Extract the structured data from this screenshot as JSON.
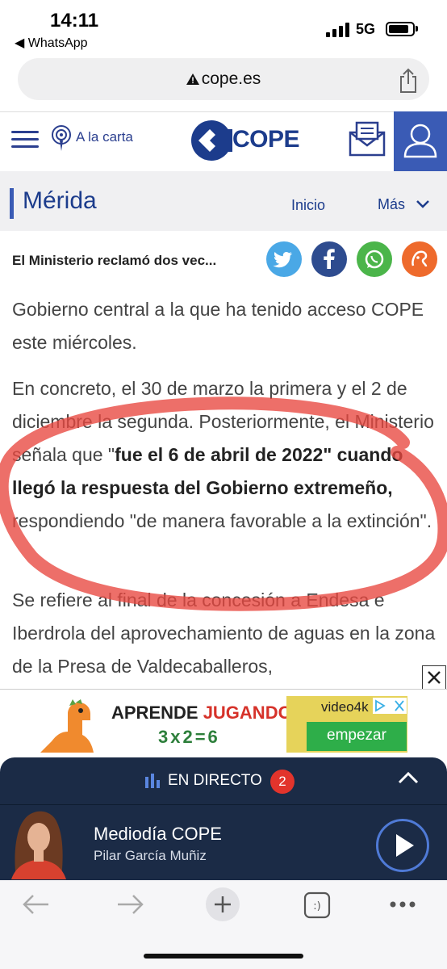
{
  "status_bar": {
    "time": "14:11",
    "back_app": "◀ WhatsApp",
    "network": "5G"
  },
  "browser": {
    "url": "cope.es"
  },
  "site_header": {
    "carta_label": "A la carta",
    "brand": "COPE"
  },
  "section": {
    "title": "Mérida",
    "nav_inicio": "Inicio",
    "nav_mas": "Más"
  },
  "share_strip": {
    "headline": "El Ministerio reclamó dos vec..."
  },
  "article": {
    "p1": "Gobierno central a la que ha tenido acceso COPE este miércoles.",
    "p2_a": "En concreto, el 30 de marzo la primera y el 2 de diciembre la segunda. Posteriormente, el Ministerio señala que \"",
    "p2_bold": "fue el 6 de abril de 2022\" cuando llegó la respuesta del Gobierno extremeño,",
    "p2_b": " respondiendo \"de manera favorable a la extinción\".",
    "p3": "Se refiere al final de la concesión a Endesa e Iberdrola del aprovechamiento de aguas en la zona de la Presa de Valdecaballeros,"
  },
  "ad": {
    "line1_a": "APRENDE ",
    "line1_b": "JUGANDO",
    "line2": "3x2=6",
    "brand": "video4k",
    "cta": "empezar"
  },
  "player": {
    "live_label": "EN DIRECTO",
    "live_count": "2",
    "show_title": "Mediodía COPE",
    "host": "Pilar García Muñiz"
  },
  "colors": {
    "brand_blue": "#1c3c8c",
    "player_bg": "#1b2b46",
    "annotation_red": "#e8473f"
  }
}
